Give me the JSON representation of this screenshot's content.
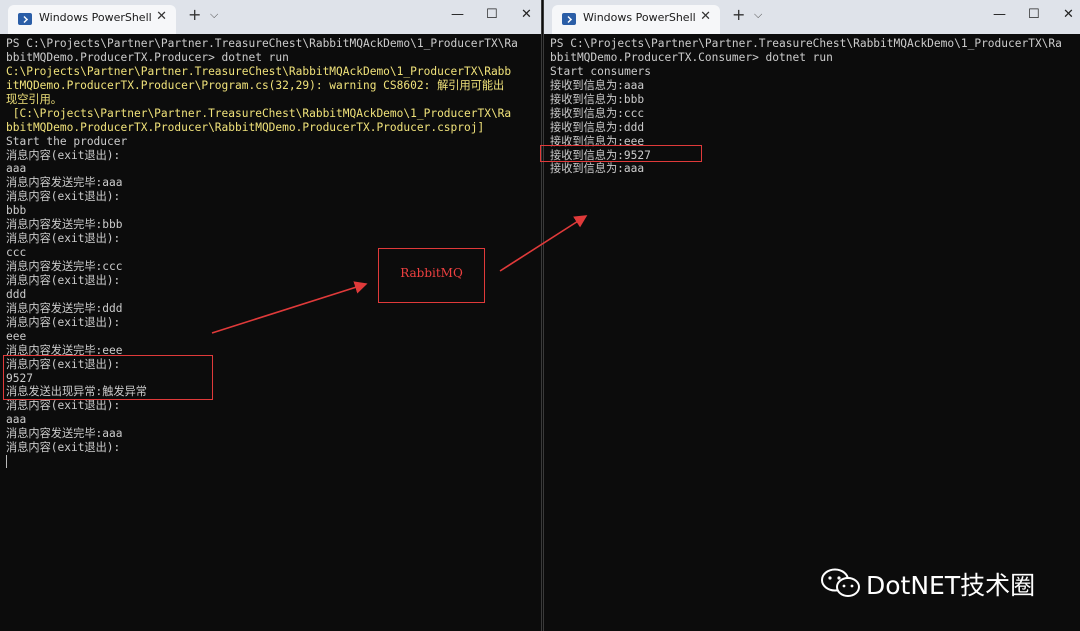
{
  "left_window": {
    "tab_title": "Windows PowerShell",
    "lines": [
      {
        "text": "PS C:\\Projects\\Partner\\Partner.TreasureChest\\RabbitMQAckDemo\\1_ProducerTX\\Ra",
        "style": "normal"
      },
      {
        "text": "bbitMQDemo.ProducerTX.Producer> dotnet run",
        "style": "normal"
      },
      {
        "text": "C:\\Projects\\Partner\\Partner.TreasureChest\\RabbitMQAckDemo\\1_ProducerTX\\Rabb",
        "style": "warn"
      },
      {
        "text": "itMQDemo.ProducerTX.Producer\\Program.cs(32,29): warning CS8602: 解引用可能出",
        "style": "warn"
      },
      {
        "text": "现空引用。",
        "style": "warn"
      },
      {
        "text": " [C:\\Projects\\Partner\\Partner.TreasureChest\\RabbitMQAckDemo\\1_ProducerTX\\Ra",
        "style": "warn"
      },
      {
        "text": "bbitMQDemo.ProducerTX.Producer\\RabbitMQDemo.ProducerTX.Producer.csproj]",
        "style": "warn"
      },
      {
        "text": "Start the producer",
        "style": "normal"
      },
      {
        "text": "消息内容(exit退出):",
        "style": "normal"
      },
      {
        "text": "aaa",
        "style": "normal"
      },
      {
        "text": "消息内容发送完毕:aaa",
        "style": "normal"
      },
      {
        "text": "消息内容(exit退出):",
        "style": "normal"
      },
      {
        "text": "bbb",
        "style": "normal"
      },
      {
        "text": "消息内容发送完毕:bbb",
        "style": "normal"
      },
      {
        "text": "消息内容(exit退出):",
        "style": "normal"
      },
      {
        "text": "ccc",
        "style": "normal"
      },
      {
        "text": "消息内容发送完毕:ccc",
        "style": "normal"
      },
      {
        "text": "消息内容(exit退出):",
        "style": "normal"
      },
      {
        "text": "ddd",
        "style": "normal"
      },
      {
        "text": "消息内容发送完毕:ddd",
        "style": "normal"
      },
      {
        "text": "消息内容(exit退出):",
        "style": "normal"
      },
      {
        "text": "eee",
        "style": "normal"
      },
      {
        "text": "消息内容发送完毕:eee",
        "style": "normal"
      },
      {
        "text": "消息内容(exit退出):",
        "style": "normal"
      },
      {
        "text": "9527",
        "style": "normal"
      },
      {
        "text": "消息发送出现异常:触发异常",
        "style": "normal"
      },
      {
        "text": "消息内容(exit退出):",
        "style": "normal"
      },
      {
        "text": "aaa",
        "style": "normal"
      },
      {
        "text": "消息内容发送完毕:aaa",
        "style": "normal"
      },
      {
        "text": "消息内容(exit退出):",
        "style": "normal"
      }
    ]
  },
  "right_window": {
    "tab_title": "Windows PowerShell",
    "lines": [
      {
        "text": "PS C:\\Projects\\Partner\\Partner.TreasureChest\\RabbitMQAckDemo\\1_ProducerTX\\Ra",
        "style": "normal"
      },
      {
        "text": "bbitMQDemo.ProducerTX.Consumer> dotnet run",
        "style": "normal"
      },
      {
        "text": "Start consumers",
        "style": "normal"
      },
      {
        "text": "接收到信息为:aaa",
        "style": "normal"
      },
      {
        "text": "接收到信息为:bbb",
        "style": "normal"
      },
      {
        "text": "接收到信息为:ccc",
        "style": "normal"
      },
      {
        "text": "接收到信息为:ddd",
        "style": "normal"
      },
      {
        "text": "接收到信息为:eee",
        "style": "normal"
      },
      {
        "text": "接收到信息为:9527",
        "style": "normal"
      },
      {
        "text": "接收到信息为:aaa",
        "style": "normal"
      }
    ]
  },
  "annotation": {
    "label": "RabbitMQ",
    "color": "#e03a3a"
  },
  "watermark": {
    "text": "DotNET技术圈",
    "icon": "wechat-icon"
  },
  "window_controls": {
    "tab_close": "✕",
    "new_tab": "+",
    "dropdown": "⌵",
    "minimize": "—",
    "maximize": "☐",
    "close": "✕"
  }
}
